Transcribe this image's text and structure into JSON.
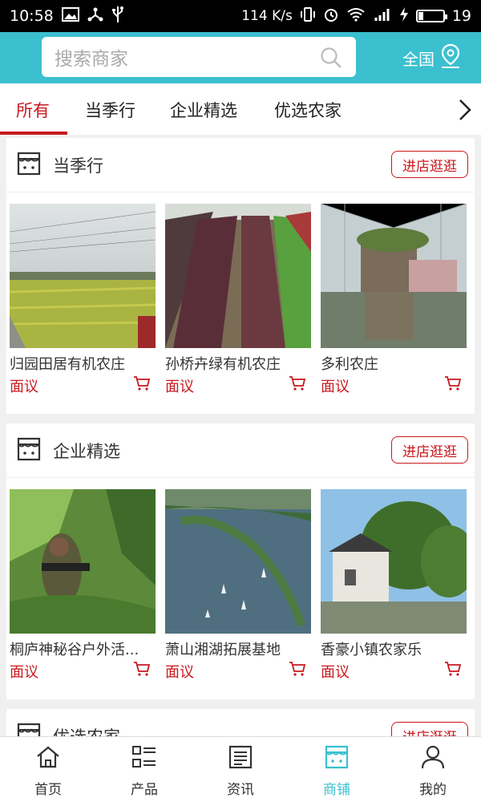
{
  "status_bar": {
    "time": "10:58",
    "network_speed": "114 K/s",
    "battery_level": "19"
  },
  "header": {
    "search_placeholder": "搜索商家",
    "region_label": "全国"
  },
  "tabs": [
    {
      "label": "所有",
      "active": true
    },
    {
      "label": "当季行",
      "active": false
    },
    {
      "label": "企业精选",
      "active": false
    },
    {
      "label": "优选农家",
      "active": false
    }
  ],
  "sections": [
    {
      "title": "当季行",
      "button_label": "进店逛逛",
      "items": [
        {
          "name": "归园田居有机农庄",
          "price": "面议",
          "image": "rapeseed-field-photo"
        },
        {
          "name": "孙桥卉绿有机农庄",
          "price": "面议",
          "image": "greenhouse-lettuce-photo"
        },
        {
          "name": "多利农庄",
          "price": "面议",
          "image": "glass-greenhouse-garden-photo"
        }
      ]
    },
    {
      "title": "企业精选",
      "button_label": "进店逛逛",
      "items": [
        {
          "name": "桐庐神秘谷户外活...",
          "price": "面议",
          "image": "outdoor-cs-game-photo"
        },
        {
          "name": "萧山湘湖拓展基地",
          "price": "面议",
          "image": "lake-aerial-photo"
        },
        {
          "name": "香豪小镇农家乐",
          "price": "面议",
          "image": "village-house-trees-photo"
        }
      ]
    },
    {
      "title": "优选农家",
      "button_label": "进店逛逛"
    }
  ],
  "bottom_nav": [
    {
      "label": "首页",
      "icon": "home-icon",
      "active": false
    },
    {
      "label": "产品",
      "icon": "list-icon",
      "active": false
    },
    {
      "label": "资讯",
      "icon": "news-icon",
      "active": false
    },
    {
      "label": "商铺",
      "icon": "store-icon",
      "active": true
    },
    {
      "label": "我的",
      "icon": "user-icon",
      "active": false
    }
  ],
  "colors": {
    "brand": "#3bc0cf",
    "accent_red": "#c8191e"
  }
}
